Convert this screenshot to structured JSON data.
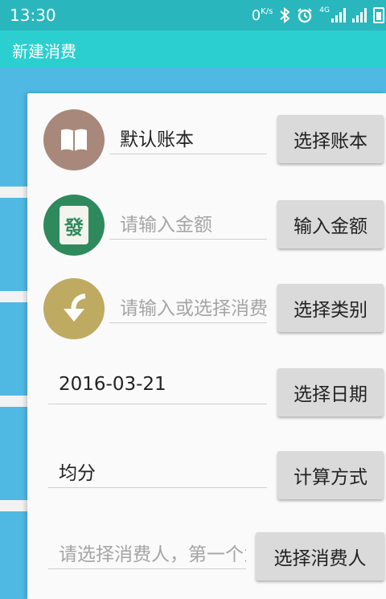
{
  "status_bar": {
    "time": "13:30",
    "speed_value": "0",
    "speed_unit": "K/s",
    "network": "4G",
    "icons": [
      "bluetooth-icon",
      "alarm-icon",
      "signal-icon",
      "battery-icon"
    ]
  },
  "app_bar": {
    "title": "新建消费"
  },
  "form": {
    "account_value": "默认账本",
    "account_button": "选择账本",
    "amount_placeholder": "请输入金额",
    "amount_button": "输入金额",
    "category_placeholder": "请输入或选择消费类别",
    "category_button": "选择类别",
    "date_value": "2016-03-21",
    "date_button": "选择日期",
    "calc_value": "均分",
    "calc_button": "计算方式",
    "payer_placeholder": "请选择消费人，第一个为付款人",
    "payer_button": "选择消费人"
  },
  "colors": {
    "status_bar": "#29b7bd",
    "app_bar": "#2ccfcf",
    "background": "#4fb9e3",
    "book_icon": "#a8887a",
    "mahjong_icon": "#2e8a5c",
    "arrow_icon": "#bfaa62"
  }
}
